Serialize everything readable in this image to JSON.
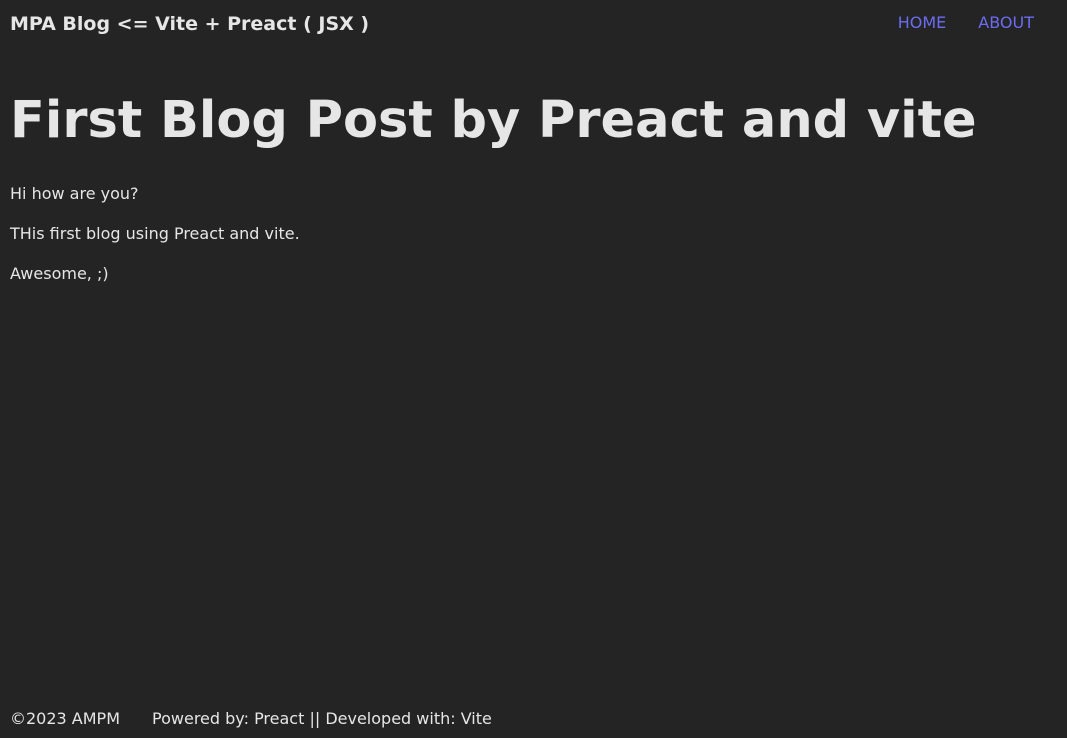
{
  "header": {
    "site_title": "MPA Blog <= Vite + Preact ( JSX )",
    "nav": [
      {
        "label": "HOME"
      },
      {
        "label": "ABOUT"
      }
    ]
  },
  "post": {
    "title": "First Blog Post by Preact and vite",
    "paragraphs": [
      "Hi how are you?",
      "THis first blog using Preact and vite.",
      "Awesome, ;)"
    ]
  },
  "footer": {
    "copyright": "©2023 AMPM",
    "credits": "Powered by: Preact || Developed with: Vite"
  },
  "colors": {
    "background": "#242424",
    "text": "#e6e6e6",
    "link": "#6c6cf2"
  }
}
